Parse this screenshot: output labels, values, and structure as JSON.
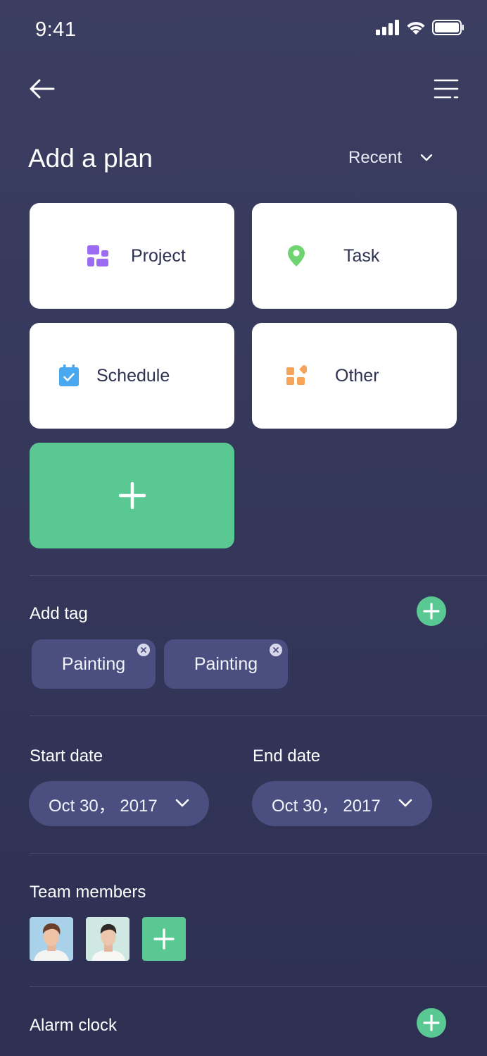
{
  "status_bar": {
    "time": "9:41"
  },
  "header": {
    "title": "Add a plan",
    "sort_label": "Recent"
  },
  "plan_types": [
    {
      "label": "Project",
      "icon": "project-icon",
      "color": "#9b6cf2"
    },
    {
      "label": "Task",
      "icon": "location-pin-icon",
      "color": "#6fd36f"
    },
    {
      "label": "Schedule",
      "icon": "calendar-check-icon",
      "color": "#4aa8f0"
    },
    {
      "label": "Other",
      "icon": "shapes-icon",
      "color": "#f8a35a"
    }
  ],
  "tags": {
    "label": "Add tag",
    "items": [
      {
        "label": "Painting"
      },
      {
        "label": "Painting"
      }
    ]
  },
  "dates": {
    "start_label": "Start date",
    "start_value": "Oct 30， 2017",
    "end_label": "End date",
    "end_value": "Oct 30， 2017"
  },
  "team": {
    "label": "Team members"
  },
  "alarm": {
    "label": "Alarm clock"
  },
  "colors": {
    "accent": "#5ac892",
    "pill": "#4a4f80",
    "card_text": "#2e3150"
  }
}
